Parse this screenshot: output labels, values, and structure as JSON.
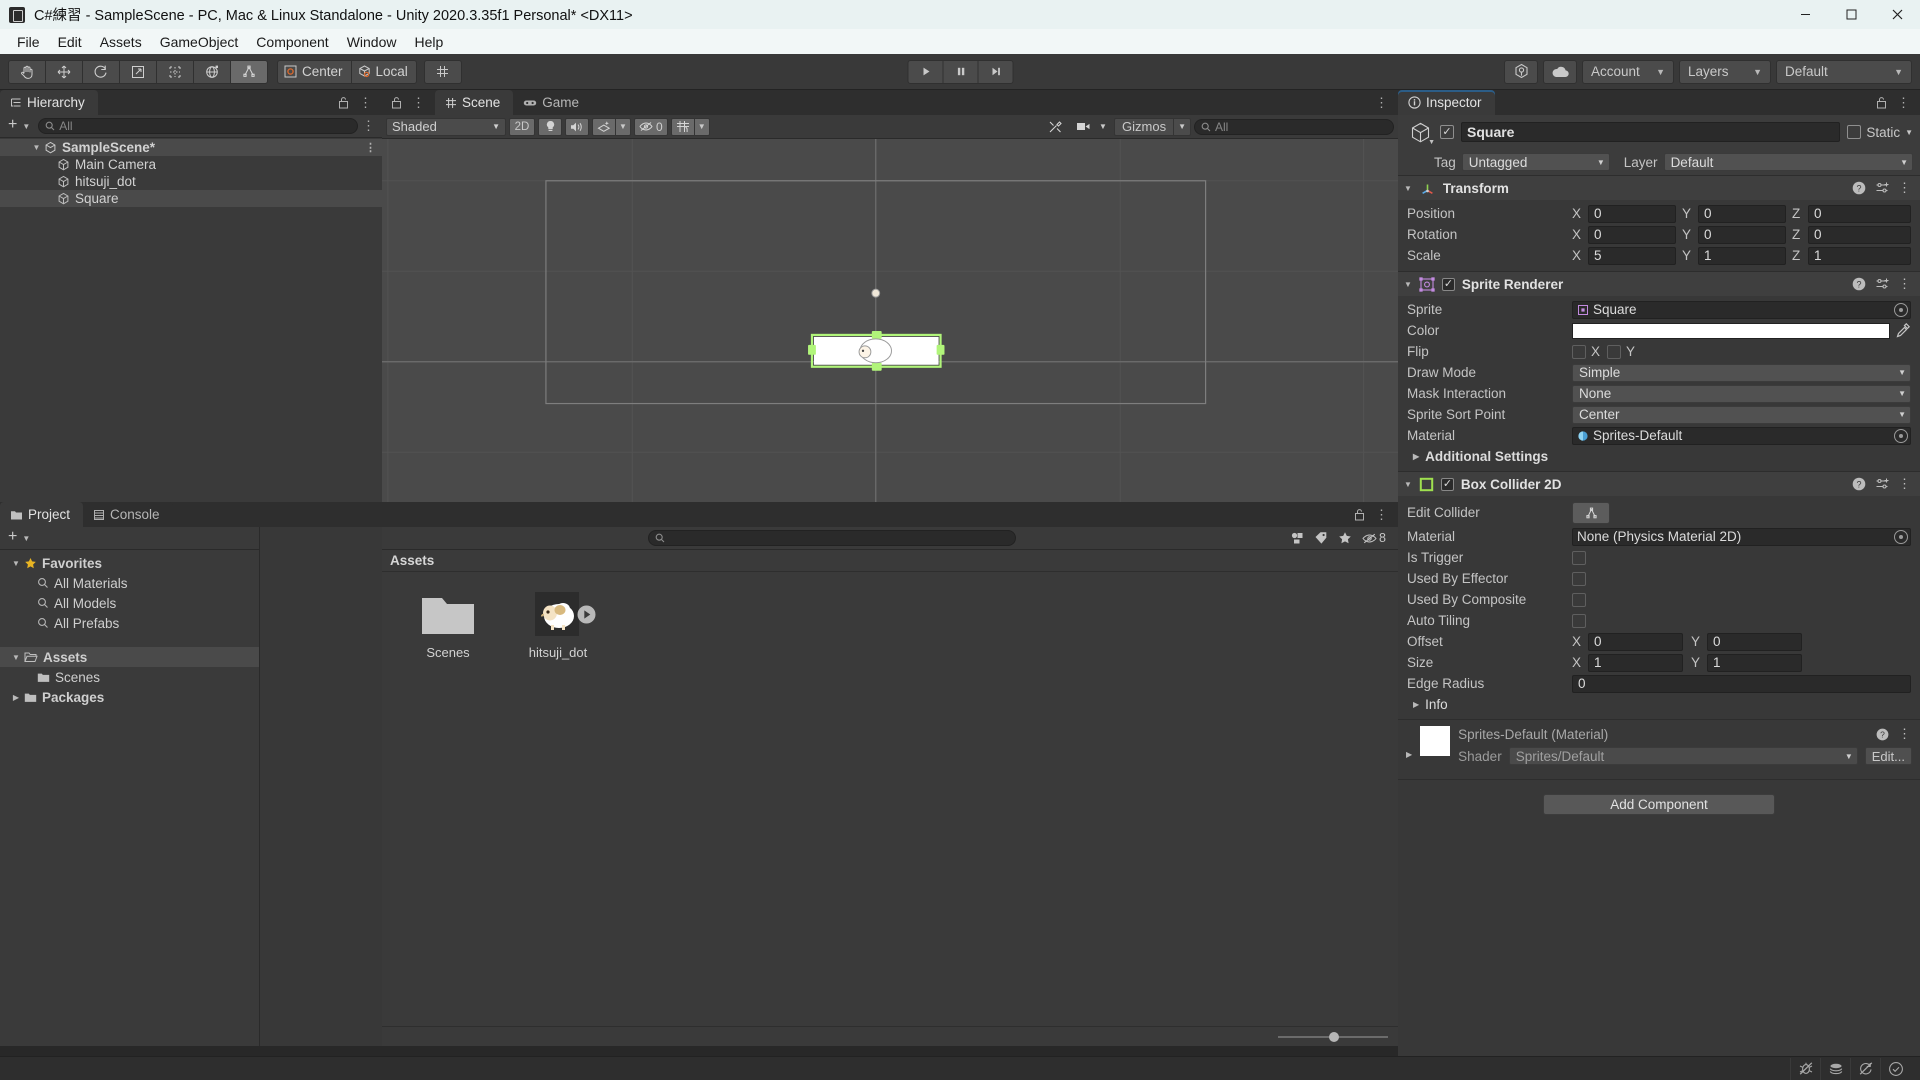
{
  "window": {
    "title": "C#練習 - SampleScene - PC, Mac & Linux Standalone - Unity 2020.3.35f1 Personal* <DX11>",
    "app_icon": "unity-icon",
    "minimize": "–",
    "maximize": "□",
    "close": "✕"
  },
  "menubar": {
    "items": [
      {
        "label": "File"
      },
      {
        "label": "Edit"
      },
      {
        "label": "Assets"
      },
      {
        "label": "GameObject"
      },
      {
        "label": "Component"
      },
      {
        "label": "Window"
      },
      {
        "label": "Help"
      }
    ]
  },
  "toolbar": {
    "tools": [
      {
        "name": "hand-tool",
        "active": false
      },
      {
        "name": "move-tool",
        "active": false
      },
      {
        "name": "rotate-tool",
        "active": false
      },
      {
        "name": "scale-tool",
        "active": false
      },
      {
        "name": "rect-tool",
        "active": false
      },
      {
        "name": "transform-tool",
        "active": false
      },
      {
        "name": "custom-editor-tool",
        "active": true
      }
    ],
    "pivot_label": "Center",
    "handle_label": "Local",
    "grid_snap": "grid-snap-icon",
    "play": "▶",
    "pause": "❚❚",
    "step": "▶❘",
    "collab_icon": "plastic-scm-icon",
    "cloud_icon": "cloud-icon",
    "account_label": "Account",
    "layers_label": "Layers",
    "layout_label": "Default"
  },
  "hierarchy": {
    "tab_label": "Hierarchy",
    "tab_icon": "hierarchy-icon",
    "create_label": "+",
    "search_placeholder": "All",
    "items": [
      {
        "label": "SampleScene*",
        "depth": 0,
        "icon": "scene-icon",
        "expanded": true,
        "selected": false,
        "is_scene": true
      },
      {
        "label": "Main Camera",
        "depth": 1,
        "icon": "gameobject-icon",
        "expanded": false,
        "selected": false,
        "is_scene": false
      },
      {
        "label": "hitsuji_dot",
        "depth": 1,
        "icon": "gameobject-icon",
        "expanded": false,
        "selected": false,
        "is_scene": false
      },
      {
        "label": "Square",
        "depth": 1,
        "icon": "gameobject-icon",
        "expanded": false,
        "selected": true,
        "is_scene": false
      }
    ]
  },
  "scene": {
    "tabs": [
      {
        "label": "Scene",
        "icon": "scene-tab-icon",
        "active": true
      },
      {
        "label": "Game",
        "icon": "game-tab-icon",
        "active": false
      }
    ],
    "draw_mode": "Shaded",
    "mode_2d": "2D",
    "lighting_icon": "lighting-icon",
    "audio_icon": "audio-icon",
    "fx_icon": "effects-icon",
    "hidden_icon": "hidden-objects-icon",
    "hidden_count": "0",
    "grid_icon": "grid-visibility-icon",
    "tools_icon": "scene-tools-icon",
    "camera_icon": "scene-camera-icon",
    "gizmos_label": "Gizmos",
    "search_placeholder": "All"
  },
  "project": {
    "tabs": [
      {
        "label": "Project",
        "icon": "project-icon",
        "active": true
      },
      {
        "label": "Console",
        "icon": "console-icon",
        "active": false
      }
    ],
    "create_label": "+",
    "search_placeholder": "",
    "filter_icons": [
      "type-filter-icon",
      "label-filter-icon",
      "favorite-filter-icon",
      "hidden-packages-icon"
    ],
    "hidden_packages_count": "8",
    "tree": [
      {
        "label": "Favorites",
        "depth": 0,
        "icon": "star-icon",
        "caret": "▼",
        "bold": true,
        "selected": false
      },
      {
        "label": "All Materials",
        "depth": 1,
        "icon": "search-icon",
        "caret": "",
        "bold": false,
        "selected": false
      },
      {
        "label": "All Models",
        "depth": 1,
        "icon": "search-icon",
        "caret": "",
        "bold": false,
        "selected": false
      },
      {
        "label": "All Prefabs",
        "depth": 1,
        "icon": "search-icon",
        "caret": "",
        "bold": false,
        "selected": false
      },
      {
        "label": "Assets",
        "depth": 0,
        "icon": "folder-open-icon",
        "caret": "▼",
        "bold": true,
        "selected": true
      },
      {
        "label": "Scenes",
        "depth": 1,
        "icon": "folder-icon",
        "caret": "",
        "bold": false,
        "selected": false
      },
      {
        "label": "Packages",
        "depth": 0,
        "icon": "folder-icon",
        "caret": "▶",
        "bold": true,
        "selected": false
      }
    ],
    "breadcrumb": "Assets",
    "assets": [
      {
        "label": "Scenes",
        "type": "folder"
      },
      {
        "label": "hitsuji_dot",
        "type": "sprite"
      }
    ],
    "zoom_value": "46"
  },
  "inspector": {
    "tab_label": "Inspector",
    "tab_icon": "inspector-icon",
    "object_name": "Square",
    "object_enabled": true,
    "static_label": "Static",
    "static_checked": false,
    "tag_label": "Tag",
    "tag_value": "Untagged",
    "layer_label": "Layer",
    "layer_value": "Default",
    "components": [
      {
        "name": "Transform",
        "icon": "transform-icon",
        "expanded": true,
        "has_enable_toggle": false,
        "rows": [
          {
            "label": "Position",
            "type": "vector3",
            "values": [
              "0",
              "0",
              "0"
            ]
          },
          {
            "label": "Rotation",
            "type": "vector3",
            "values": [
              "0",
              "0",
              "0"
            ]
          },
          {
            "label": "Scale",
            "type": "vector3",
            "values": [
              "5",
              "1",
              "1"
            ]
          }
        ]
      },
      {
        "name": "Sprite Renderer",
        "icon": "sprite-renderer-icon",
        "expanded": true,
        "has_enable_toggle": true,
        "enabled": true,
        "rows": [
          {
            "label": "Sprite",
            "type": "object",
            "value": "Square",
            "value_icon": "sprite-icon"
          },
          {
            "label": "Color",
            "type": "color",
            "value": "#FFFFFF"
          },
          {
            "label": "Flip",
            "type": "flip",
            "x_label": "X",
            "y_label": "Y",
            "x": false,
            "y": false
          },
          {
            "label": "Draw Mode",
            "type": "dropdown",
            "value": "Simple"
          },
          {
            "label": "Mask Interaction",
            "type": "dropdown",
            "value": "None"
          },
          {
            "label": "Sprite Sort Point",
            "type": "dropdown",
            "value": "Center"
          },
          {
            "label": "Material",
            "type": "object",
            "value": "Sprites-Default",
            "value_icon": "material-icon"
          },
          {
            "label": "Additional Settings",
            "type": "foldout",
            "expanded": false
          }
        ]
      },
      {
        "name": "Box Collider 2D",
        "icon": "box-collider-2d-icon",
        "expanded": true,
        "has_enable_toggle": true,
        "enabled": true,
        "rows": [
          {
            "label": "Edit Collider",
            "type": "edit-collider",
            "value": "edit-collider-icon"
          },
          {
            "label": "Material",
            "type": "object",
            "value": "None (Physics Material 2D)",
            "value_icon": ""
          },
          {
            "label": "Is Trigger",
            "type": "checkbox",
            "checked": false
          },
          {
            "label": "Used By Effector",
            "type": "checkbox",
            "checked": false
          },
          {
            "label": "Used By Composite",
            "type": "checkbox",
            "checked": false
          },
          {
            "label": "Auto Tiling",
            "type": "checkbox",
            "checked": false
          },
          {
            "label": "Offset",
            "type": "vector2",
            "values": [
              "0",
              "0"
            ]
          },
          {
            "label": "Size",
            "type": "vector2",
            "values": [
              "1",
              "1"
            ]
          },
          {
            "label": "Edge Radius",
            "type": "number",
            "value": "0"
          },
          {
            "label": "Info",
            "type": "foldout",
            "expanded": false
          }
        ]
      }
    ],
    "material_preview": {
      "title": "Sprites-Default (Material)",
      "shader_label": "Shader",
      "shader_value": "Sprites/Default",
      "edit_label": "Edit..."
    },
    "add_component_label": "Add Component"
  },
  "statusbar": {
    "icons": [
      {
        "name": "debug-off-icon"
      },
      {
        "name": "code-coverage-icon"
      },
      {
        "name": "refresh-off-icon"
      },
      {
        "name": "ok-status-icon"
      }
    ]
  },
  "colors": {
    "accent_blue": "#2c5d87",
    "collider_green": "#b1f57a",
    "panel_bg": "#383838",
    "toolbar_bg": "#393939",
    "titlebar_bg": "#e9f2f2"
  }
}
